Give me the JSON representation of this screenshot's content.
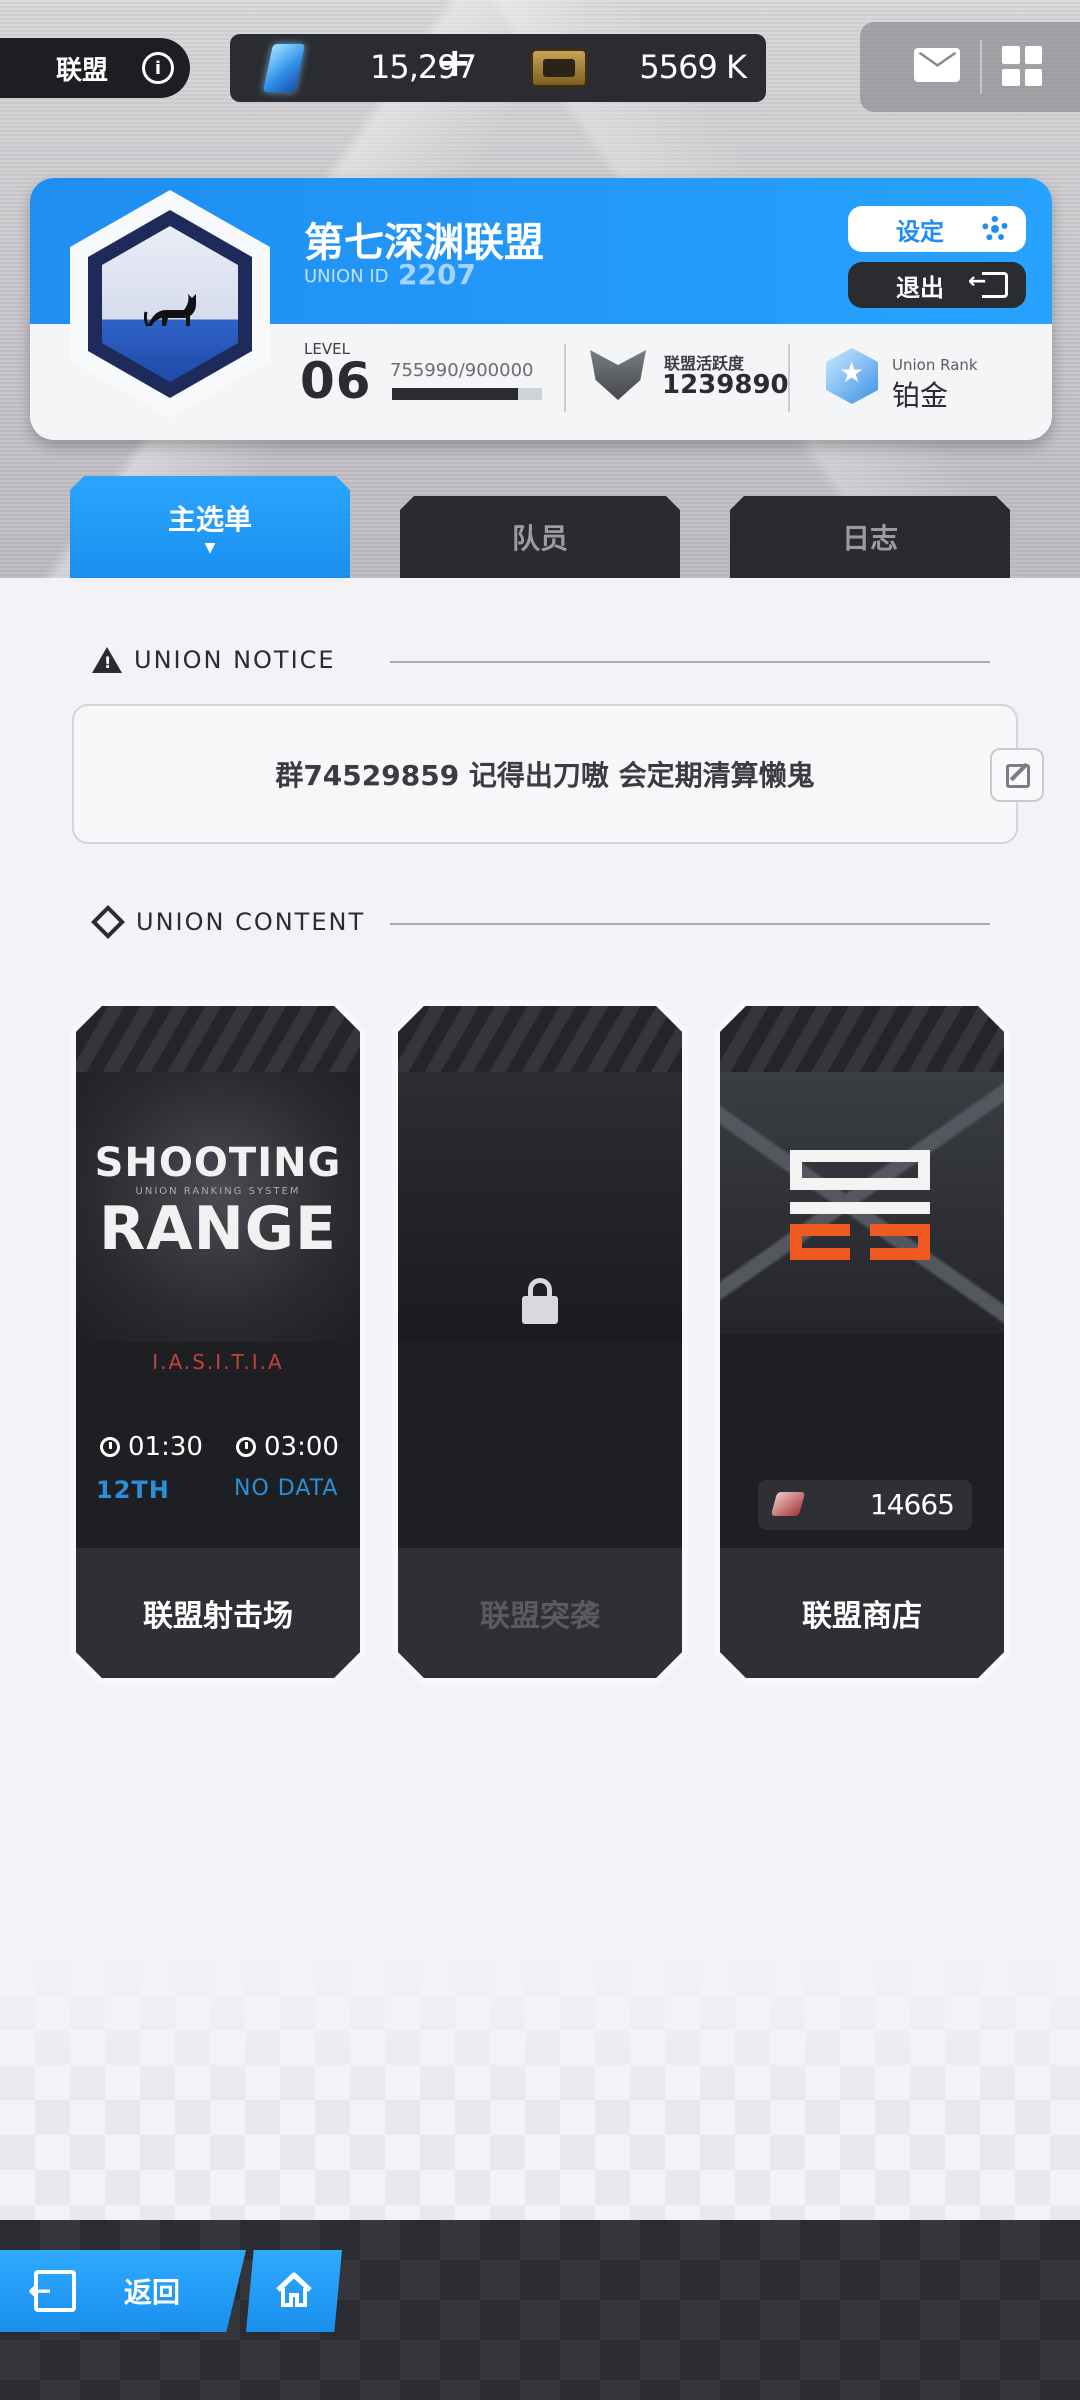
{
  "topbar": {
    "union_tag": "联盟",
    "gems": "15,297",
    "gems_plus": "+",
    "tickets": "5569 K"
  },
  "union": {
    "name": "第七深渊联盟",
    "id_label": "UNION ID",
    "id": "2207",
    "settings_label": "设定",
    "exit_label": "退出",
    "level_label": "LEVEL",
    "level": "06",
    "exp_text": "755990/900000",
    "exp_progress": 0.84,
    "activity_label": "联盟活跃度",
    "activity_value": "1239890",
    "rank_label": "Union Rank",
    "rank_value": "铂金"
  },
  "tabs": [
    {
      "label": "主选单",
      "active": true
    },
    {
      "label": "队员",
      "active": false
    },
    {
      "label": "日志",
      "active": false
    }
  ],
  "notice": {
    "heading": "UNION NOTICE",
    "text": "群74529859 记得出刀嗷 会定期清算懒鬼"
  },
  "content": {
    "heading": "UNION CONTENT",
    "shooting_range": {
      "title_top": "SHOOTING",
      "subtitle": "UNION RANKING SYSTEM",
      "title_bottom": "RANGE",
      "tag": "I.A.S.I.T.I.A",
      "timer1": "01:30",
      "timer2": "03:00",
      "rank": "12TH",
      "no_data": "NO DATA",
      "label": "联盟射击场"
    },
    "raid": {
      "label": "联盟突袭"
    },
    "shop": {
      "currency": "14665",
      "label": "联盟商店"
    }
  },
  "bottom": {
    "back_label": "返回"
  },
  "colors": {
    "accent_blue": "#1f8ef2",
    "dark": "#2a2c31",
    "shop_orange": "#f05a21"
  }
}
